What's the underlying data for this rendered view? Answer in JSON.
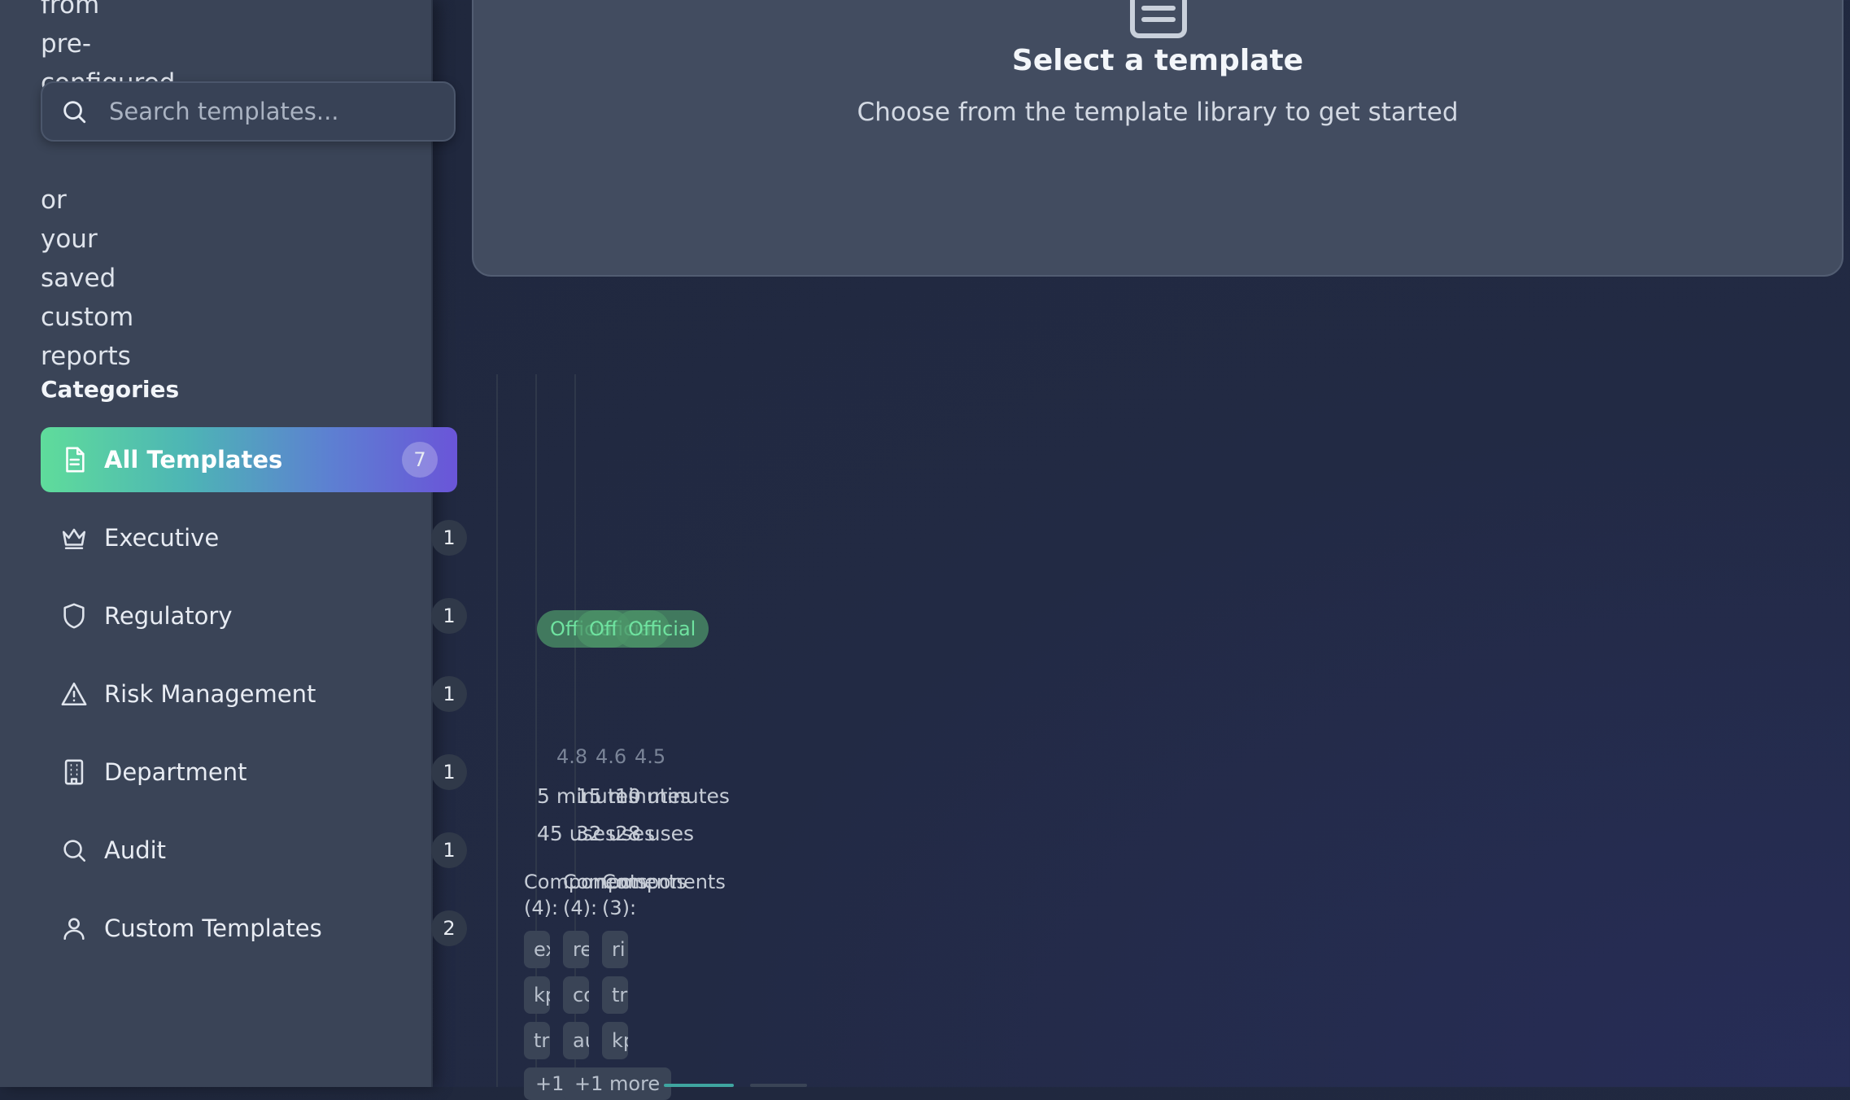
{
  "sidebar": {
    "description_words": [
      "from",
      "pre-",
      "configured",
      "or",
      "your",
      "saved",
      "custom",
      "reports"
    ],
    "search": {
      "placeholder": "Search templates..."
    },
    "categories_title": "Categories",
    "categories": [
      {
        "label": "All Templates",
        "count": "7",
        "icon": "document-icon",
        "active": true
      },
      {
        "label": "Executive",
        "count": "1",
        "icon": "crown-icon"
      },
      {
        "label": "Regulatory",
        "count": "1",
        "icon": "shield-icon"
      },
      {
        "label": "Risk Management",
        "count": "1",
        "icon": "warning-triangle-icon"
      },
      {
        "label": "Department",
        "count": "1",
        "icon": "building-icon"
      },
      {
        "label": "Audit",
        "count": "1",
        "icon": "search-icon"
      },
      {
        "label": "Custom Templates",
        "count": "2",
        "icon": "user-icon"
      }
    ]
  },
  "main": {
    "empty_state": {
      "icon": "template-document-icon",
      "title": "Select a template",
      "subtitle": "Choose from the template library to get started"
    },
    "cards": [
      {
        "badge": "Official",
        "rating": "4.8",
        "time": "5 minutes",
        "uses": "45 uses",
        "components_label": "Components (4):",
        "chips": [
          "ex",
          "kp",
          "tr"
        ],
        "more": "+1 more"
      },
      {
        "badge": "Official",
        "rating": "4.6",
        "time": "15 minutes",
        "uses": "32 uses",
        "components_label": "Components (4):",
        "chips": [
          "re",
          "co",
          "au"
        ],
        "more": "+1 more"
      },
      {
        "badge": "Official",
        "rating": "4.5",
        "time": "10 minutes",
        "uses": "28 uses",
        "components_label": "Components (3):",
        "chips": [
          "ri",
          "tr",
          "kp"
        ],
        "more": ""
      }
    ]
  },
  "colors": {
    "accent_start": "#5fdc9b",
    "accent_end": "#6a55d8",
    "sidebar_bg": "#3a4457",
    "panel_bg": "#424c60",
    "badge_text": "#6fe3a0"
  }
}
